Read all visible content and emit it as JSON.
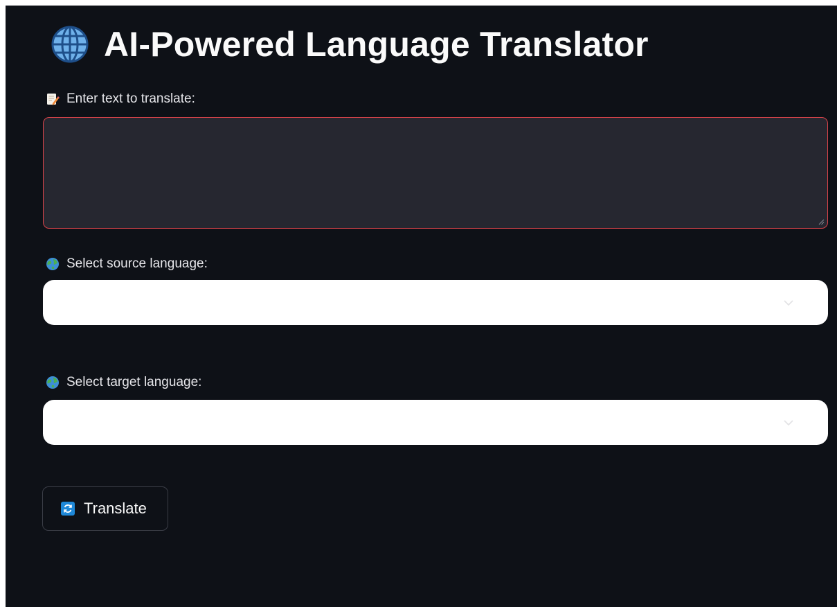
{
  "header": {
    "title": "AI-Powered Language Translator",
    "icon": "globe-icon"
  },
  "input_section": {
    "label": "Enter text to translate:",
    "label_icon": "memo-icon",
    "value": "",
    "placeholder": ""
  },
  "source_language": {
    "label": "Select source language:",
    "label_icon": "earth-icon",
    "selected": ""
  },
  "target_language": {
    "label": "Select target language:",
    "label_icon": "earth-icon",
    "selected": ""
  },
  "actions": {
    "translate_label": "Translate",
    "translate_icon": "refresh-icon"
  },
  "colors": {
    "background": "#0e1117",
    "text_area_bg": "#262730",
    "text_area_border": "#d9434a",
    "select_bg": "#ffffff",
    "text": "#fafafa"
  }
}
